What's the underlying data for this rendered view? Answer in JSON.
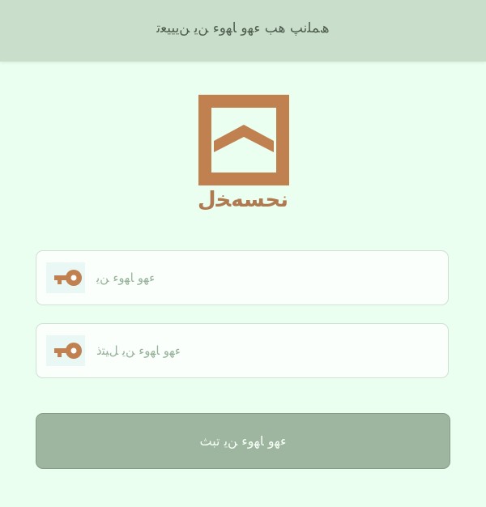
{
  "header": {
    "title": "ھﻤﻠﻧﭗ ﻫﺐ ﺀﻬﻭ ﺎﻬﻭﺀ ﻦﻳ ﻦﻳﻴﻴﻌﺗ"
  },
  "logo": {
    "icon": "house-chevron-logo",
    "brand_text": "ﻧﺤﺴﻪﺨﻝ",
    "color": "#c08050"
  },
  "login_form": {
    "username_placeholder": "ﺀﻬﻭ ﺎﻬﻭﺀ ﻦﻳ",
    "password_placeholder": "ﺀﻬﻭ ﺎﻬﻭﺀ ﻦﻳ ﻞﻴﺘﺫ",
    "key_icon": "key-icon",
    "submit_label": "ﺀﻬﻭ ﺎﻬﻭﺀ ﻦﻳ ﺗﺒﺚ"
  },
  "colors": {
    "background": "#eafff0",
    "header": "#c9dfcb",
    "accent": "#c08050",
    "button": "#9eb5a0"
  }
}
